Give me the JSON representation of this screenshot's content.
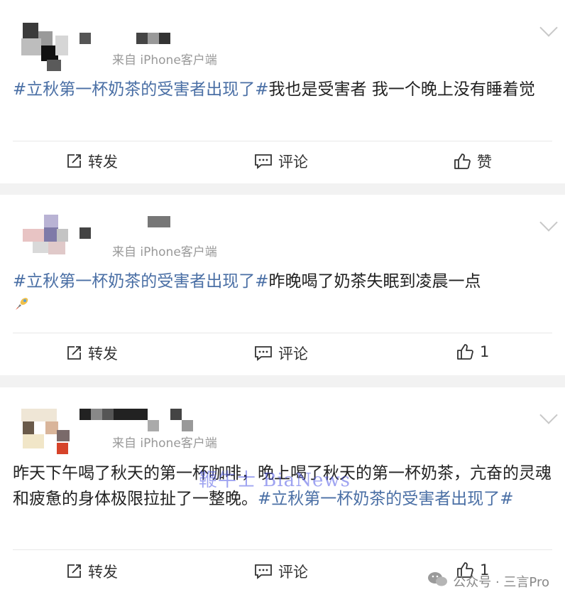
{
  "posts": [
    {
      "source": "来自 iPhone客户端",
      "topic": "#立秋第一杯奶茶的受害者出现了#",
      "body": "我也是受害者 我一个晚上没有睡着觉",
      "actions": {
        "repost": "转发",
        "comment": "评论",
        "like": "赞"
      }
    },
    {
      "source": "来自 iPhone客户端",
      "topic": "#立秋第一杯奶茶的受害者出现了#",
      "body": "昨晚喝了奶茶失眠到凌晨一点",
      "actions": {
        "repost": "转发",
        "comment": "评论",
        "like": "1"
      }
    },
    {
      "source": "来自 iPhone客户端",
      "body_prefix": "昨天下午喝了秋天的第一杯咖啡，晚上喝了秋天的第一杯奶茶，亢奋的灵魂和疲惫的身体极限拉扯了一整晚。",
      "topic": "#立秋第一杯奶茶的受害者出现了#",
      "actions": {
        "repost": "转发",
        "comment": "评论",
        "like": "1"
      }
    }
  ],
  "watermarks": {
    "center": "鞭牛士 BiaNews",
    "bottom_right": "公众号 · 三言Pro"
  },
  "icons": {
    "repost": "repost-icon",
    "comment": "comment-icon",
    "like": "thumbs-up-icon",
    "more": "chevron-down-icon",
    "emoji": "rocket-emoji-icon",
    "wechat": "wechat-icon"
  },
  "colors": {
    "topic": "#4a6fa5",
    "text": "#222222",
    "muted": "#999999",
    "background": "#f2f2f2"
  }
}
